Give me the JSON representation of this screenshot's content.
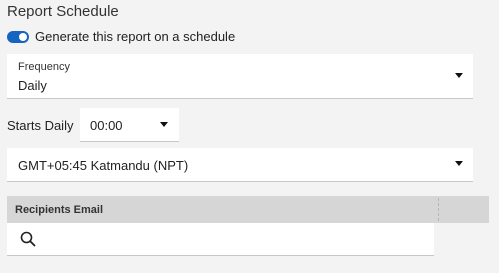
{
  "section": {
    "title": "Report Schedule"
  },
  "schedule_toggle": {
    "label": "Generate this report on a schedule",
    "enabled": true,
    "color": "#1565c0"
  },
  "frequency": {
    "label": "Frequency",
    "value": "Daily"
  },
  "starts": {
    "label": "Starts Daily",
    "time": "00:00"
  },
  "timezone": {
    "value": "GMT+05:45 Katmandu (NPT)"
  },
  "recipients": {
    "header": "Recipients Email",
    "search_icon": "search-icon"
  }
}
